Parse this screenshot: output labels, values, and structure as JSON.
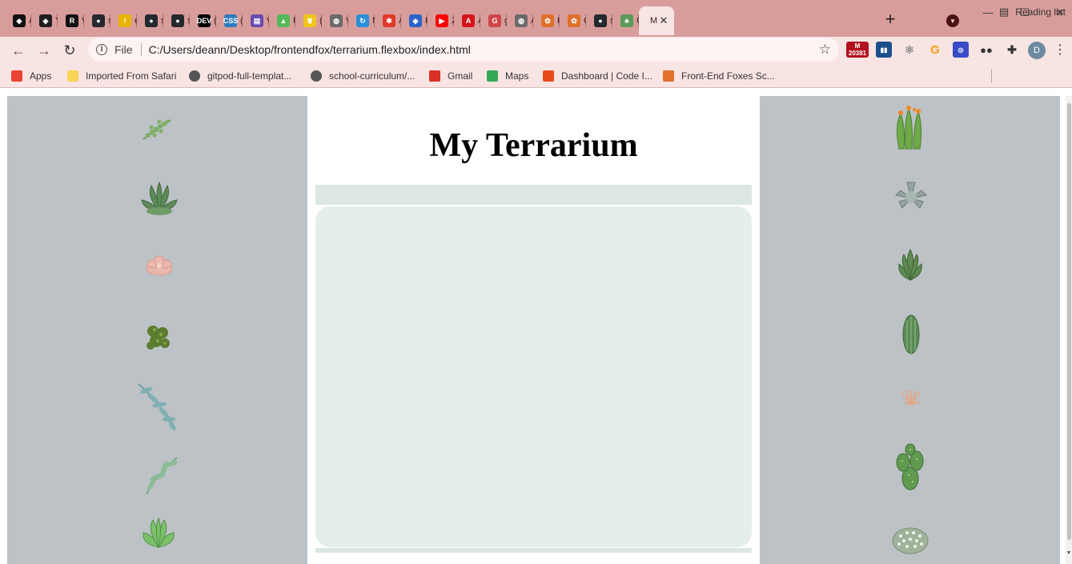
{
  "browser": {
    "tabs": [
      {
        "icon": "panther-icon",
        "title": "A",
        "color": "#111111",
        "glyph": "◆"
      },
      {
        "icon": "codepen-icon",
        "title": "Y",
        "color": "#1e1e1e",
        "glyph": "◈"
      },
      {
        "icon": "replit-r-icon",
        "title": "V",
        "color": "#111111",
        "glyph": "R"
      },
      {
        "icon": "github-icon",
        "title": "s",
        "color": "#24292e",
        "glyph": "●"
      },
      {
        "icon": "emoji-icon",
        "title": "e",
        "color": "#e8b400",
        "glyph": "!"
      },
      {
        "icon": "github-icon",
        "title": "s",
        "color": "#24292e",
        "glyph": "●"
      },
      {
        "icon": "github-icon",
        "title": "s",
        "color": "#24292e",
        "glyph": "●"
      },
      {
        "icon": "dev-icon",
        "title": "(",
        "color": "#000000",
        "glyph": "DEV"
      },
      {
        "icon": "css-grid-icon",
        "title": "(",
        "color": "#2f7bbf",
        "glyph": "CSS"
      },
      {
        "icon": "flexbox-game-icon",
        "title": "V",
        "color": "#6a4bb0",
        "glyph": "▤"
      },
      {
        "icon": "frog-icon",
        "title": "F",
        "color": "#56b85a",
        "glyph": "▲"
      },
      {
        "icon": "crown-icon",
        "title": "(",
        "color": "#f0c419",
        "glyph": "♛"
      },
      {
        "icon": "globe-icon",
        "title": "V",
        "color": "#6b6b6b",
        "glyph": "◍"
      },
      {
        "icon": "loop-icon",
        "title": "N",
        "color": "#2a8fd8",
        "glyph": "↻"
      },
      {
        "icon": "asterisk-icon",
        "title": "A",
        "color": "#e0392b",
        "glyph": "✱"
      },
      {
        "icon": "diamond-icon",
        "title": "H",
        "color": "#2b63c9",
        "glyph": "◆"
      },
      {
        "icon": "youtube-icon",
        "title": "Z",
        "color": "#ff0000",
        "glyph": "▶"
      },
      {
        "icon": "acrobat-icon",
        "title": "A",
        "color": "#d4131a",
        "glyph": "A"
      },
      {
        "icon": "gulp-icon",
        "title": "g",
        "color": "#cf4647",
        "glyph": "G"
      },
      {
        "icon": "globe-icon",
        "title": "A",
        "color": "#6b6b6b",
        "glyph": "◍"
      },
      {
        "icon": "fox-icon",
        "title": "H",
        "color": "#e0702b",
        "glyph": "✿"
      },
      {
        "icon": "fox-icon",
        "title": "C",
        "color": "#e0702b",
        "glyph": "✿"
      },
      {
        "icon": "github-icon",
        "title": "s",
        "color": "#24292e",
        "glyph": "●"
      },
      {
        "icon": "terrarium-icon",
        "title": "C",
        "color": "#5a9a5a",
        "glyph": "♣"
      }
    ],
    "active_tab": {
      "icon": "page-icon",
      "title": "M"
    },
    "address": {
      "scheme": "File",
      "url": "C:/Users/deann/Desktop/frontendfox/terrarium.flexbox/index.html"
    },
    "extension_badge": "20381",
    "profile_initial": "D",
    "bookmarks": [
      {
        "label": "Apps",
        "icon": "apps-grid-icon",
        "color": "#ea4335"
      },
      {
        "label": "Imported From Safari",
        "icon": "folder-icon",
        "color": "#f7d358"
      },
      {
        "label": "gitpod-full-templat...",
        "icon": "github-icon",
        "color": "#555555"
      },
      {
        "label": "school-curriculum/...",
        "icon": "github-icon",
        "color": "#555555"
      },
      {
        "label": "Gmail",
        "icon": "gmail-icon",
        "color": "#d93025"
      },
      {
        "label": "Maps",
        "icon": "maps-icon",
        "color": "#34a853"
      },
      {
        "label": "Dashboard | Code I...",
        "icon": "codeinstitute-icon",
        "color": "#ea4a19"
      },
      {
        "label": "Front-End Foxes Sc...",
        "icon": "fox-icon",
        "color": "#e0702b"
      }
    ],
    "reading_list": "Reading list"
  },
  "page": {
    "title": "My Terrarium"
  }
}
